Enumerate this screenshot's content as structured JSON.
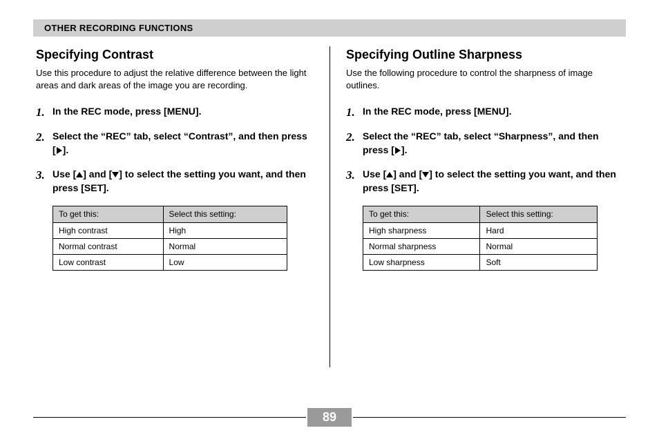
{
  "section_header": "OTHER RECORDING FUNCTIONS",
  "page_number": "89",
  "left": {
    "title": "Specifying Contrast",
    "intro": "Use this procedure to adjust the relative difference between the light areas and dark areas of the image you are recording.",
    "step1": "In the REC mode, press [MENU].",
    "step2_a": "Select the “REC” tab, select “Contrast”, and then press [",
    "step2_b": "].",
    "step3_a": "Use [",
    "step3_b": "] and [",
    "step3_c": "] to select the setting you want, and then press [SET].",
    "table": {
      "h1": "To get this:",
      "h2": "Select this setting:",
      "rows": [
        {
          "a": "High contrast",
          "b": "High"
        },
        {
          "a": "Normal contrast",
          "b": "Normal"
        },
        {
          "a": "Low contrast",
          "b": "Low"
        }
      ]
    }
  },
  "right": {
    "title": "Specifying Outline Sharpness",
    "intro": "Use the following procedure to control the sharpness of image outlines.",
    "step1": "In the REC mode, press [MENU].",
    "step2_a": "Select the “REC” tab, select “Sharpness”, and then press [",
    "step2_b": "].",
    "step3_a": "Use [",
    "step3_b": "] and [",
    "step3_c": "] to select the setting you want, and then press [SET].",
    "table": {
      "h1": "To get this:",
      "h2": "Select this setting:",
      "rows": [
        {
          "a": "High sharpness",
          "b": "Hard"
        },
        {
          "a": "Normal sharpness",
          "b": "Normal"
        },
        {
          "a": "Low sharpness",
          "b": "Soft"
        }
      ]
    }
  }
}
